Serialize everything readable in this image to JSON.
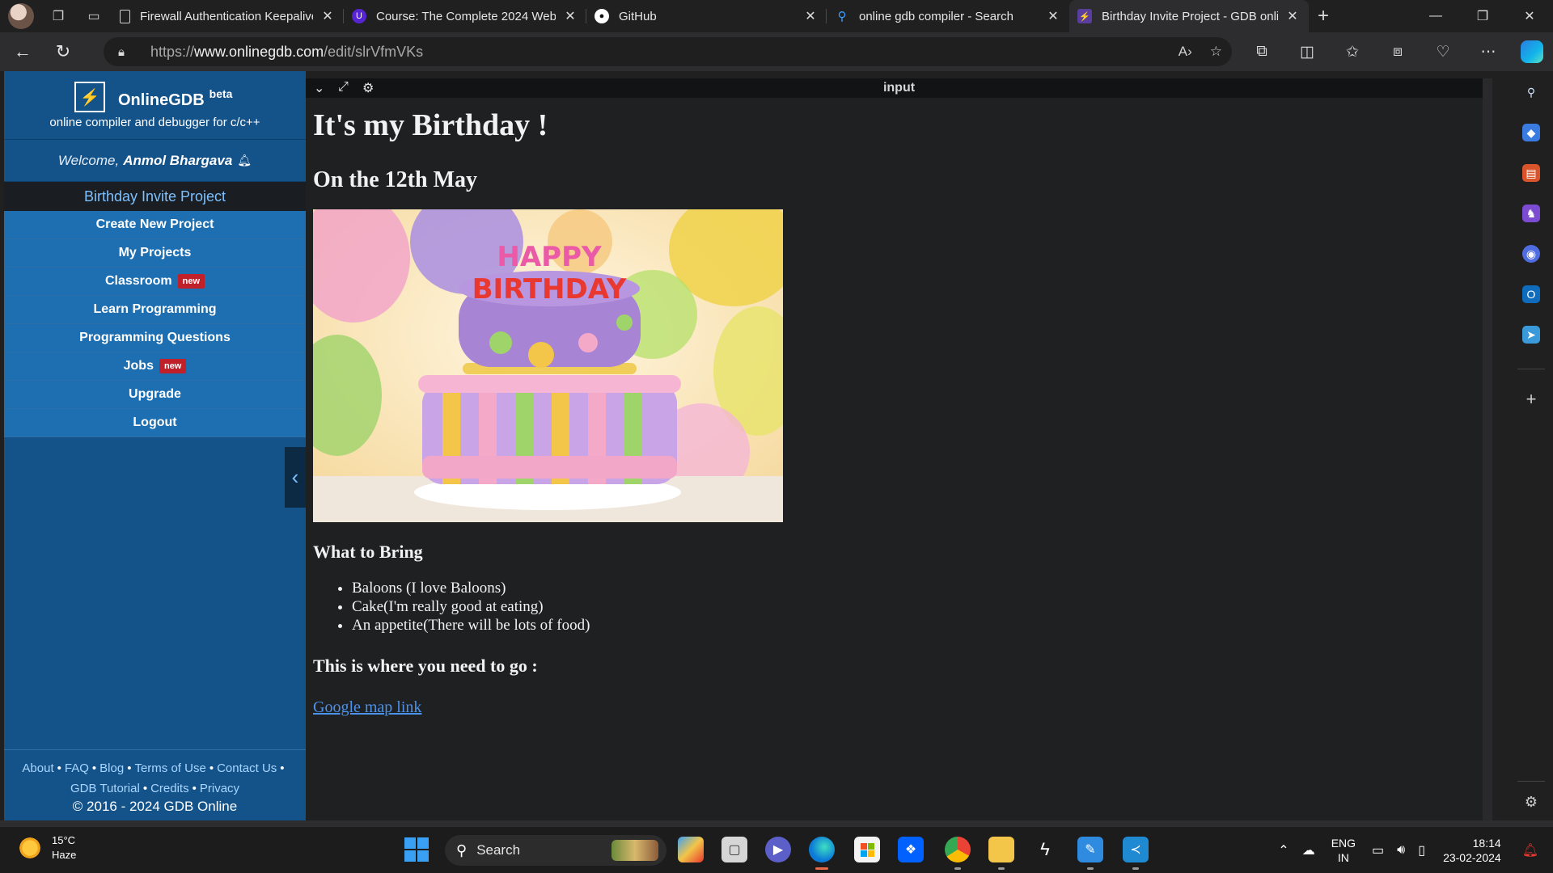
{
  "browser": {
    "tabs": [
      {
        "title": "Firewall Authentication Keepalive"
      },
      {
        "title": "Course: The Complete 2024 Web"
      },
      {
        "title": "GitHub"
      },
      {
        "title": "online gdb compiler - Search"
      },
      {
        "title": "Birthday Invite Project - GDB onli"
      }
    ],
    "url_prefix": "https://",
    "url_host": "www.onlinegdb.com",
    "url_path": "/edit/slrVfmVKs"
  },
  "sidebar": {
    "brand_name": "OnlineGDB",
    "brand_beta": "beta",
    "tagline": "online compiler and debugger for c/c++",
    "welcome_prefix": "Welcome,",
    "user_name": "Anmol Bhargava",
    "project_name": "Birthday Invite Project",
    "menu": [
      {
        "label": "Create New Project"
      },
      {
        "label": "My Projects"
      },
      {
        "label": "Classroom",
        "badge": "new"
      },
      {
        "label": "Learn Programming"
      },
      {
        "label": "Programming Questions"
      },
      {
        "label": "Jobs",
        "badge": "new"
      },
      {
        "label": "Upgrade"
      },
      {
        "label": "Logout"
      }
    ],
    "footer_links": [
      "About",
      "FAQ",
      "Blog",
      "Terms of Use",
      "Contact Us",
      "GDB Tutorial",
      "Credits",
      "Privacy"
    ],
    "copyright": "© 2016 - 2024 GDB Online"
  },
  "panel": {
    "label": "input"
  },
  "page": {
    "h1": "It's my Birthday !",
    "h2": "On the 12th May",
    "cake_text_1": "HAPPY",
    "cake_text_2": "BIRTHDAY",
    "what_to_bring": "What to Bring",
    "items": [
      "Baloons (I love Baloons)",
      "Cake(I'm really good at eating)",
      "An appetite(There will be lots of food)"
    ],
    "where_heading": "This is where you need to go :",
    "map_link": "Google map link"
  },
  "taskbar": {
    "temperature": "15°C",
    "condition": "Haze",
    "search_label": "Search",
    "lang_1": "ENG",
    "lang_2": "IN",
    "time": "18:14",
    "date": "23-02-2024"
  }
}
